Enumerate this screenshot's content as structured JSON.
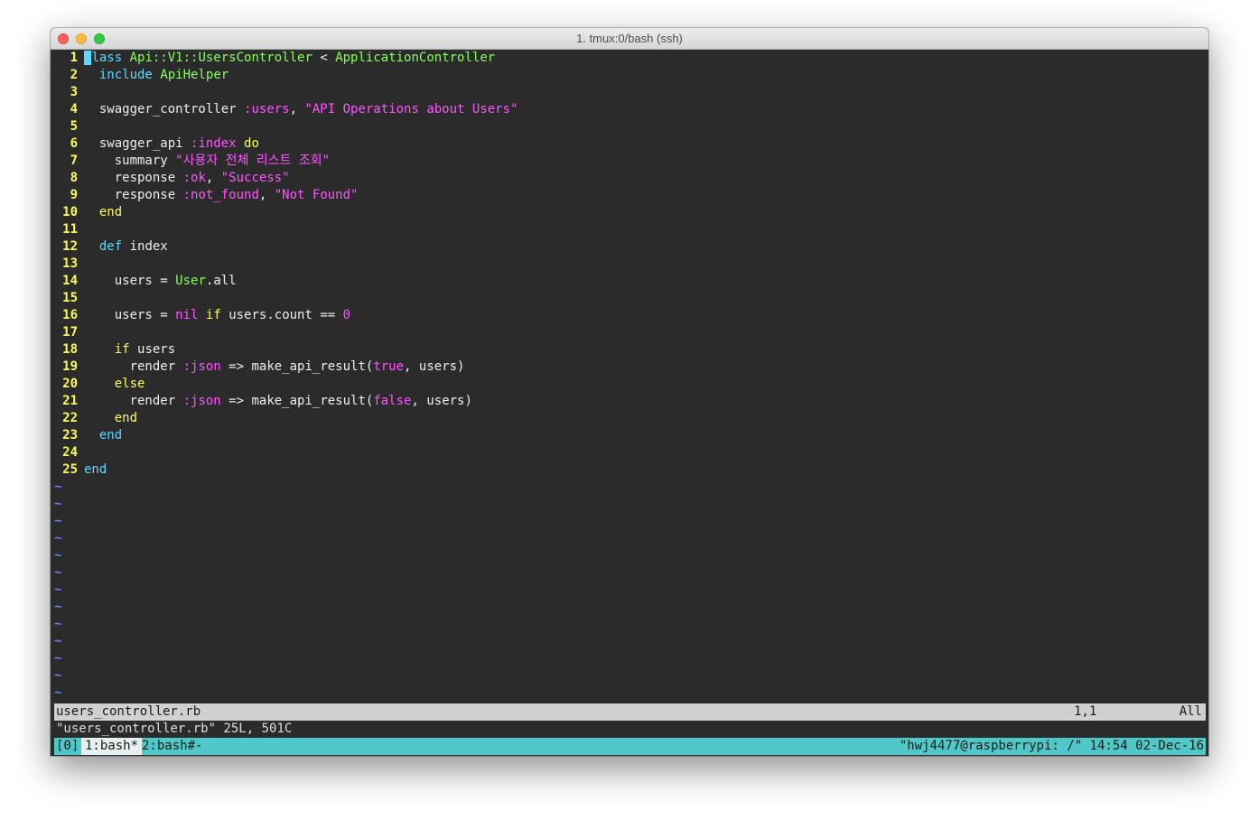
{
  "window": {
    "title": "1. tmux:0/bash (ssh)"
  },
  "editor": {
    "lines": [
      {
        "n": "1"
      },
      {
        "n": "2"
      },
      {
        "n": "3"
      },
      {
        "n": "4"
      },
      {
        "n": "5"
      },
      {
        "n": "6"
      },
      {
        "n": "7"
      },
      {
        "n": "8"
      },
      {
        "n": "9"
      },
      {
        "n": "10"
      },
      {
        "n": "11"
      },
      {
        "n": "12"
      },
      {
        "n": "13"
      },
      {
        "n": "14"
      },
      {
        "n": "15"
      },
      {
        "n": "16"
      },
      {
        "n": "17"
      },
      {
        "n": "18"
      },
      {
        "n": "19"
      },
      {
        "n": "20"
      },
      {
        "n": "21"
      },
      {
        "n": "22"
      },
      {
        "n": "23"
      },
      {
        "n": "24"
      },
      {
        "n": "25"
      }
    ],
    "code": {
      "l1_cursor": "c",
      "l1_kw": "lass",
      "l1_const1": "Api::V1::UsersController",
      "l1_op": " < ",
      "l1_const2": "ApplicationController",
      "l2_kw": "include",
      "l2_const": "ApiHelper",
      "l4_fn": "swagger_controller",
      "l4_sym": ":users",
      "l4_str": "\"API Operations about Users\"",
      "l6_fn": "swagger_api",
      "l6_sym": ":index",
      "l6_kw": "do",
      "l7_fn": "summary",
      "l7_str": "\"사용자 전체 리스트 조회\"",
      "l8_fn": "response",
      "l8_sym": ":ok",
      "l8_str": "\"Success\"",
      "l9_fn": "response",
      "l9_sym": ":not_found",
      "l9_str": "\"Not Found\"",
      "l10_kw": "end",
      "l12_kw": "def",
      "l12_name": "index",
      "l14_var": "users",
      "l14_op": " = ",
      "l14_const": "User",
      "l14_call": ".all",
      "l16_var": "users",
      "l16_op": " = ",
      "l16_nil": "nil",
      "l16_if": "if",
      "l16_expr": "users.count == ",
      "l16_num": "0",
      "l18_if": "if",
      "l18_var": "users",
      "l19_fn": "render",
      "l19_sym": ":json",
      "l19_rest1": " => make_api_result(",
      "l19_bool": "true",
      "l19_rest2": ", users)",
      "l20_kw": "else",
      "l21_fn": "render",
      "l21_sym": ":json",
      "l21_rest1": " => make_api_result(",
      "l21_bool": "false",
      "l21_rest2": ", users)",
      "l22_kw": "end",
      "l23_kw": "end",
      "l25_kw": "end"
    },
    "tilde": "~"
  },
  "statusline": {
    "filename": "users_controller.rb",
    "position": "1,1",
    "scroll": "All"
  },
  "message": "\"users_controller.rb\" 25L, 501C",
  "tmux": {
    "session": "[0]",
    "window1": "1:bash*",
    "window2": "2:bash#-",
    "right": "\"hwj4477@raspberrypi: /\" 14:54 02-Dec-16"
  },
  "colors": {
    "background": "#2b2b2b",
    "line_number": "#fdfd5a",
    "keyword": "#5fd7ff",
    "constant": "#87ff5f",
    "string": "#ff55ff",
    "tilde": "#5f87ff",
    "tmux_bar": "#50c8c8"
  }
}
